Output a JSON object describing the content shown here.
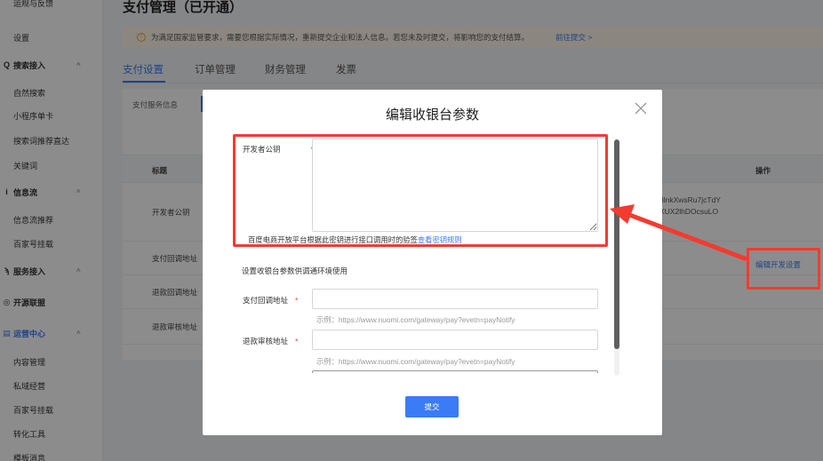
{
  "sidebar": {
    "items": [
      {
        "label": "运规与反馈",
        "kind": "sub"
      },
      {
        "label": "设置",
        "kind": "sub"
      },
      {
        "label": "搜索接入",
        "kind": "group",
        "icon": "search-icon",
        "chev": "^"
      },
      {
        "label": "自然搜索",
        "kind": "sub"
      },
      {
        "label": "小程序单卡",
        "kind": "sub"
      },
      {
        "label": "搜索词推荐直达",
        "kind": "sub"
      },
      {
        "label": "关键词",
        "kind": "sub"
      },
      {
        "label": "信息流",
        "kind": "group",
        "icon": "feed-icon",
        "chev": "^"
      },
      {
        "label": "信息流推荐",
        "kind": "sub"
      },
      {
        "label": "百家号挂载",
        "kind": "sub"
      },
      {
        "label": "服务接入",
        "kind": "group",
        "icon": "service-icon",
        "chev": "^"
      },
      {
        "label": "开源联盟",
        "kind": "group",
        "icon": "alliance-icon",
        "chev": ""
      },
      {
        "label": "运营中心",
        "kind": "group",
        "icon": "operation-icon",
        "chev": "^",
        "active": true
      },
      {
        "label": "内容管理",
        "kind": "sub"
      },
      {
        "label": "私域经营",
        "kind": "sub"
      },
      {
        "label": "百家号挂载",
        "kind": "sub"
      },
      {
        "label": "转化工具",
        "kind": "sub"
      },
      {
        "label": "模板消息",
        "kind": "sub"
      }
    ]
  },
  "header": {
    "title": "支付管理（已开通）"
  },
  "notice": {
    "text": "为满足国家监管要求，需要您根据实际情况，重新提交企业和法人信息。若您未及时提交，将影响您的支付结算。",
    "link": "前往提交 >"
  },
  "tabs": [
    {
      "label": "支付设置",
      "active": true
    },
    {
      "label": "订单管理"
    },
    {
      "label": "财务管理"
    },
    {
      "label": "发票"
    }
  ],
  "subtab": {
    "label": "支付服务信息"
  },
  "table": {
    "headers": {
      "title": "标题",
      "action": "操作"
    },
    "rows": [
      {
        "label": "开发者公钥",
        "value_line1": "8lnkXwsRu7jcTdY",
        "value_line2": "XUX2lhDOcsuLO"
      },
      {
        "label": "支付回调地址"
      },
      {
        "label": "退款回调地址"
      },
      {
        "label": "退款审核地址"
      }
    ],
    "action_label": "编辑开发设置"
  },
  "modal": {
    "title": "编辑收银台参数",
    "close_icon": "close-icon",
    "public_key_label": "开发者公钥",
    "required_mark": "*",
    "public_key_value": "",
    "public_key_hint": "百度电商开放平台根据此密钥进行接口调用时的验签",
    "public_key_hint_link": "查看密钥规则",
    "section_title": "设置收银台参数供调通环境使用",
    "pay_callback_label": "支付回调地址",
    "pay_callback_value": "",
    "pay_callback_hint": "示例：https://www.nuomi.com/gateway/pay?evetn=payNotify",
    "refund_review_label": "退款审核地址",
    "refund_review_value": "",
    "refund_review_hint": "示例：https://www.nuomi.com/gateway/pay?evetn=payNotify",
    "submit_label": "提交"
  },
  "colors": {
    "accent": "#3a7bf6",
    "highlight_red": "#f33b2f",
    "notice_bg": "#fdf6e9"
  }
}
